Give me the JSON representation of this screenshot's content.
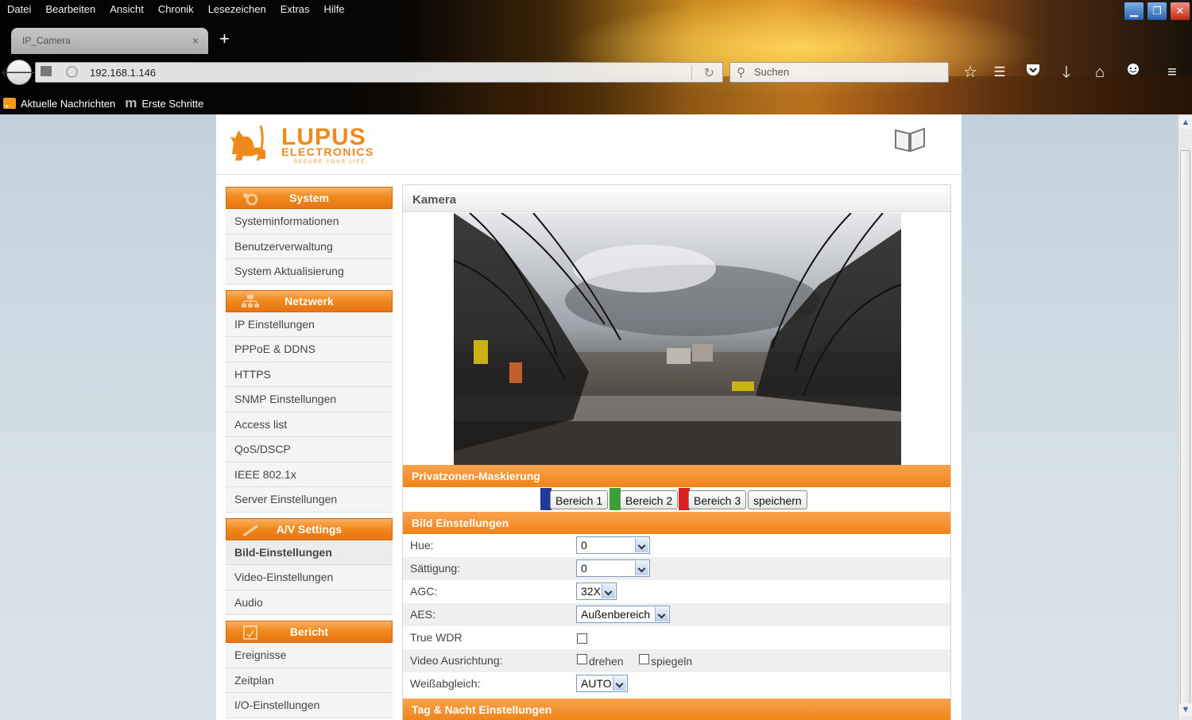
{
  "window": {
    "menu": [
      "Datei",
      "Bearbeiten",
      "Ansicht",
      "Chronik",
      "Lesezeichen",
      "Extras",
      "Hilfe"
    ],
    "tab_title": "IP_Camera",
    "tab_close": "×",
    "new_tab": "+",
    "url": "192.168.1.146",
    "search_placeholder": "Suchen",
    "bookmarks": [
      "Aktuelle Nachrichten",
      "Erste Schritte"
    ],
    "toolbar_icons": [
      "star-icon",
      "reading-list-icon",
      "pocket-icon",
      "download-icon",
      "home-icon",
      "chat-icon",
      "menu-icon"
    ]
  },
  "brand": {
    "name": "LUPUS",
    "sub": "ELECTRONICS",
    "tagline": "SECURE YOUR LIFE",
    "accent": "#ef8417"
  },
  "sidebar": {
    "groups": [
      {
        "title": "System",
        "icon": "gear-icon",
        "items": [
          "Systeminformationen",
          "Benutzerverwaltung",
          "System Aktualisierung"
        ]
      },
      {
        "title": "Netzwerk",
        "icon": "network-icon",
        "items": [
          "IP Einstellungen",
          "PPPoE & DDNS",
          "HTTPS",
          "SNMP Einstellungen",
          "Access list",
          "QoS/DSCP",
          "IEEE 802.1x",
          "Server Einstellungen"
        ]
      },
      {
        "title": "A/V Settings",
        "icon": "av-icon",
        "items": [
          "Bild-Einstellungen",
          "Video-Einstellungen",
          "Audio"
        ]
      },
      {
        "title": "Bericht",
        "icon": "report-icon",
        "items": [
          "Ereignisse",
          "Zeitplan",
          "I/O-Einstellungen"
        ]
      }
    ],
    "active_item": "Bild-Einstellungen"
  },
  "content": {
    "title": "Kamera",
    "privacy": {
      "title": "Privatzonen-Maskierung",
      "buttons": [
        "Bereich 1",
        "Bereich 2",
        "Bereich 3",
        "speichern"
      ],
      "colors": [
        "#1f3a99",
        "#37a136",
        "#d91f1f"
      ]
    },
    "image_settings": {
      "title": "Bild Einstellungen",
      "hue_label": "Hue:",
      "hue_value": "0",
      "saturation_label": "Sättigung:",
      "saturation_value": "0",
      "agc_label": "AGC:",
      "agc_value": "32X",
      "aes_label": "AES:",
      "aes_value": "Außenbereich",
      "wdr_label": "True WDR",
      "orientation_label": "Video Ausrichtung:",
      "rotate_label": "drehen",
      "mirror_label": "spiegeln",
      "wb_label": "Weißabgleich:",
      "wb_value": "AUTO"
    },
    "day_night_title": "Tag & Nacht Einstellungen"
  }
}
